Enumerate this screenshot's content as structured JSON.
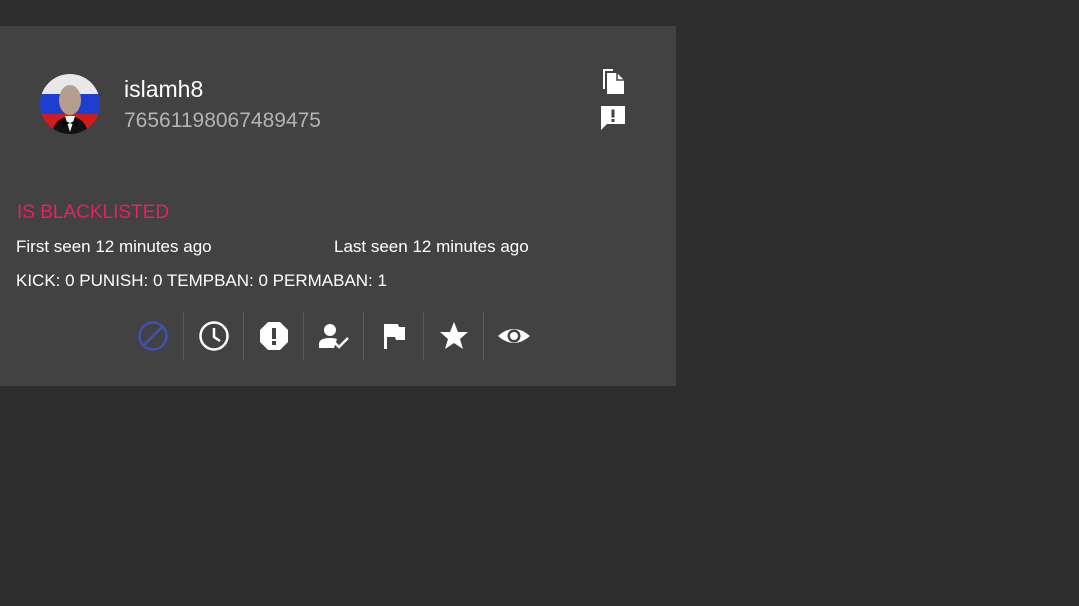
{
  "player": {
    "username": "islamh8",
    "steam_id": "76561198067489475",
    "status": "IS BLACKLISTED",
    "first_seen": "First seen 12 minutes ago",
    "last_seen": "Last seen 12 minutes ago",
    "counts": "KICK: 0 PUNISH: 0 TEMPBAN: 0 PERMABAN: 1"
  },
  "header_actions": [
    "copy-icon",
    "report-icon"
  ],
  "actions": [
    "ban-icon",
    "clock-icon",
    "warning-octagon-icon",
    "verify-user-icon",
    "flag-icon",
    "star-icon",
    "eye-icon"
  ],
  "colors": {
    "page_bg": "#2e2e2e",
    "card_bg": "#424242",
    "status_red": "#e91e63",
    "active_blue": "#3f51b5",
    "secondary_text": "#b3b3b3"
  }
}
